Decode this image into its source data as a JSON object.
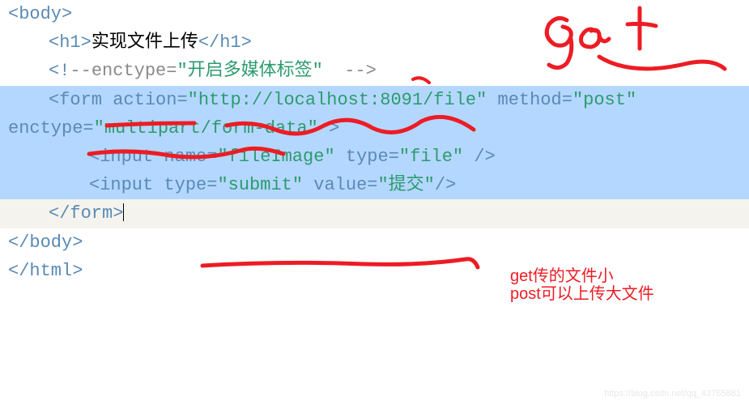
{
  "line1": {
    "lt": "<",
    "body": "body",
    "gt": ">"
  },
  "line2": {
    "lt": "<",
    "h1": "h1",
    "gt": ">",
    "text": "实现文件上传",
    "lt2": "</",
    "h1b": "h1",
    "gt2": ">"
  },
  "line3": {
    "open": "<!",
    "dash": "--",
    "attr": "enctype",
    "eq": "=",
    "val": "\"开启多媒体标签\"",
    "tail": "  -->"
  },
  "line4": {
    "lt": "<",
    "form": "form",
    "sp": " ",
    "action": "action",
    "eq": "=",
    "url": "\"http://localhost:8091/file\"",
    "sp2": " ",
    "method": "method",
    "eq2": "=",
    "post": "\"post\""
  },
  "line5": {
    "enctype": "enctype",
    "eq": "=",
    "val": "\"multipart/form-data\"",
    "sp": " ",
    "gt": ">"
  },
  "line6": {
    "lt": "<",
    "input": "input",
    "sp": " ",
    "name": "name",
    "eq": "=",
    "nval": "\"fileImage\"",
    "sp2": " ",
    "type": "type",
    "eq2": "=",
    "tval": "\"file\"",
    "sp3": " ",
    "close": "/>"
  },
  "line7": {
    "lt": "<",
    "input": "input",
    "sp": " ",
    "type": "type",
    "eq": "=",
    "tval": "\"submit\"",
    "sp2": " ",
    "value": "value",
    "eq2": "=",
    "vval": "\"提交\"",
    "close": "/>"
  },
  "line8": {
    "lt": "</",
    "form": "form",
    "gt": ">"
  },
  "line9": {
    "lt": "</",
    "body": "body",
    "gt": ">"
  },
  "line10": {
    "lt": "</",
    "html": "html",
    "gt": ">"
  },
  "annot": {
    "get_hand": "get",
    "note1": "get传的文件小",
    "note2": "post可以上传大文件"
  },
  "watermark": "https://blog.csdn.net/qq_43765881"
}
